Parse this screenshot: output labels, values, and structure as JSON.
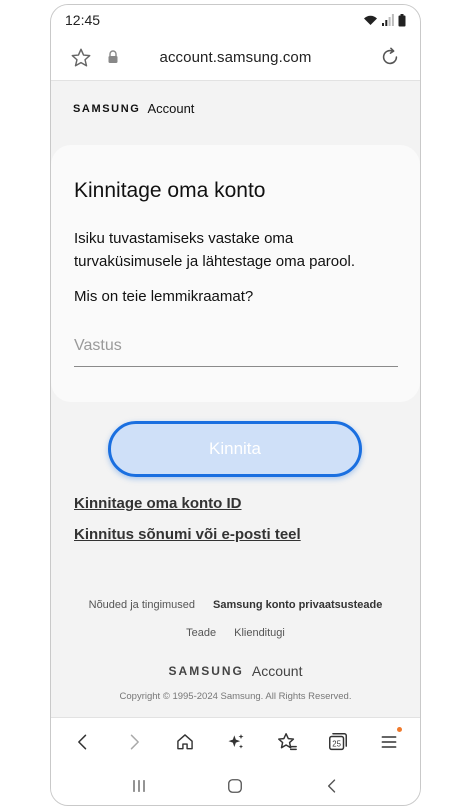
{
  "status": {
    "time": "12:45"
  },
  "browser": {
    "url": "account.samsung.com"
  },
  "brand": {
    "samsung": "SAMSUNG",
    "account": "Account"
  },
  "card": {
    "title": "Kinnitage oma konto",
    "description": "Isiku tuvastamiseks vastake oma turvaküsimusele ja lähtestage oma parool.",
    "question": "Mis on teie lemmikraamat?",
    "answer_placeholder": "Vastus",
    "answer_value": ""
  },
  "actions": {
    "confirm_label": "Kinnita",
    "link_konto_id": "Kinnitage oma konto ID",
    "link_message_email": "Kinnitus sõnumi või e-posti teel"
  },
  "footer": {
    "terms": "Nõuded ja tingimused",
    "privacy": "Samsung konto privaatsusteade",
    "notice": "Teade",
    "support": "Klienditugi",
    "brand_samsung": "SAMSUNG",
    "brand_account": "Account",
    "copyright": "Copyright © 1995-2024 Samsung. All Rights Reserved."
  },
  "toolbar": {
    "tabs_count": "25"
  },
  "colors": {
    "accent": "#1a6fe0",
    "button_fill": "#cfe0f8",
    "notification_dot": "#f07a2c"
  },
  "icons": [
    "wifi-icon",
    "signal-icon",
    "battery-icon",
    "star-icon",
    "lock-icon",
    "reload-icon",
    "back-icon",
    "forward-icon",
    "home-icon",
    "sparkle-icon",
    "bookmarks-icon",
    "tabs-icon",
    "menu-icon",
    "recents-icon",
    "home-nav-icon",
    "back-nav-icon"
  ]
}
